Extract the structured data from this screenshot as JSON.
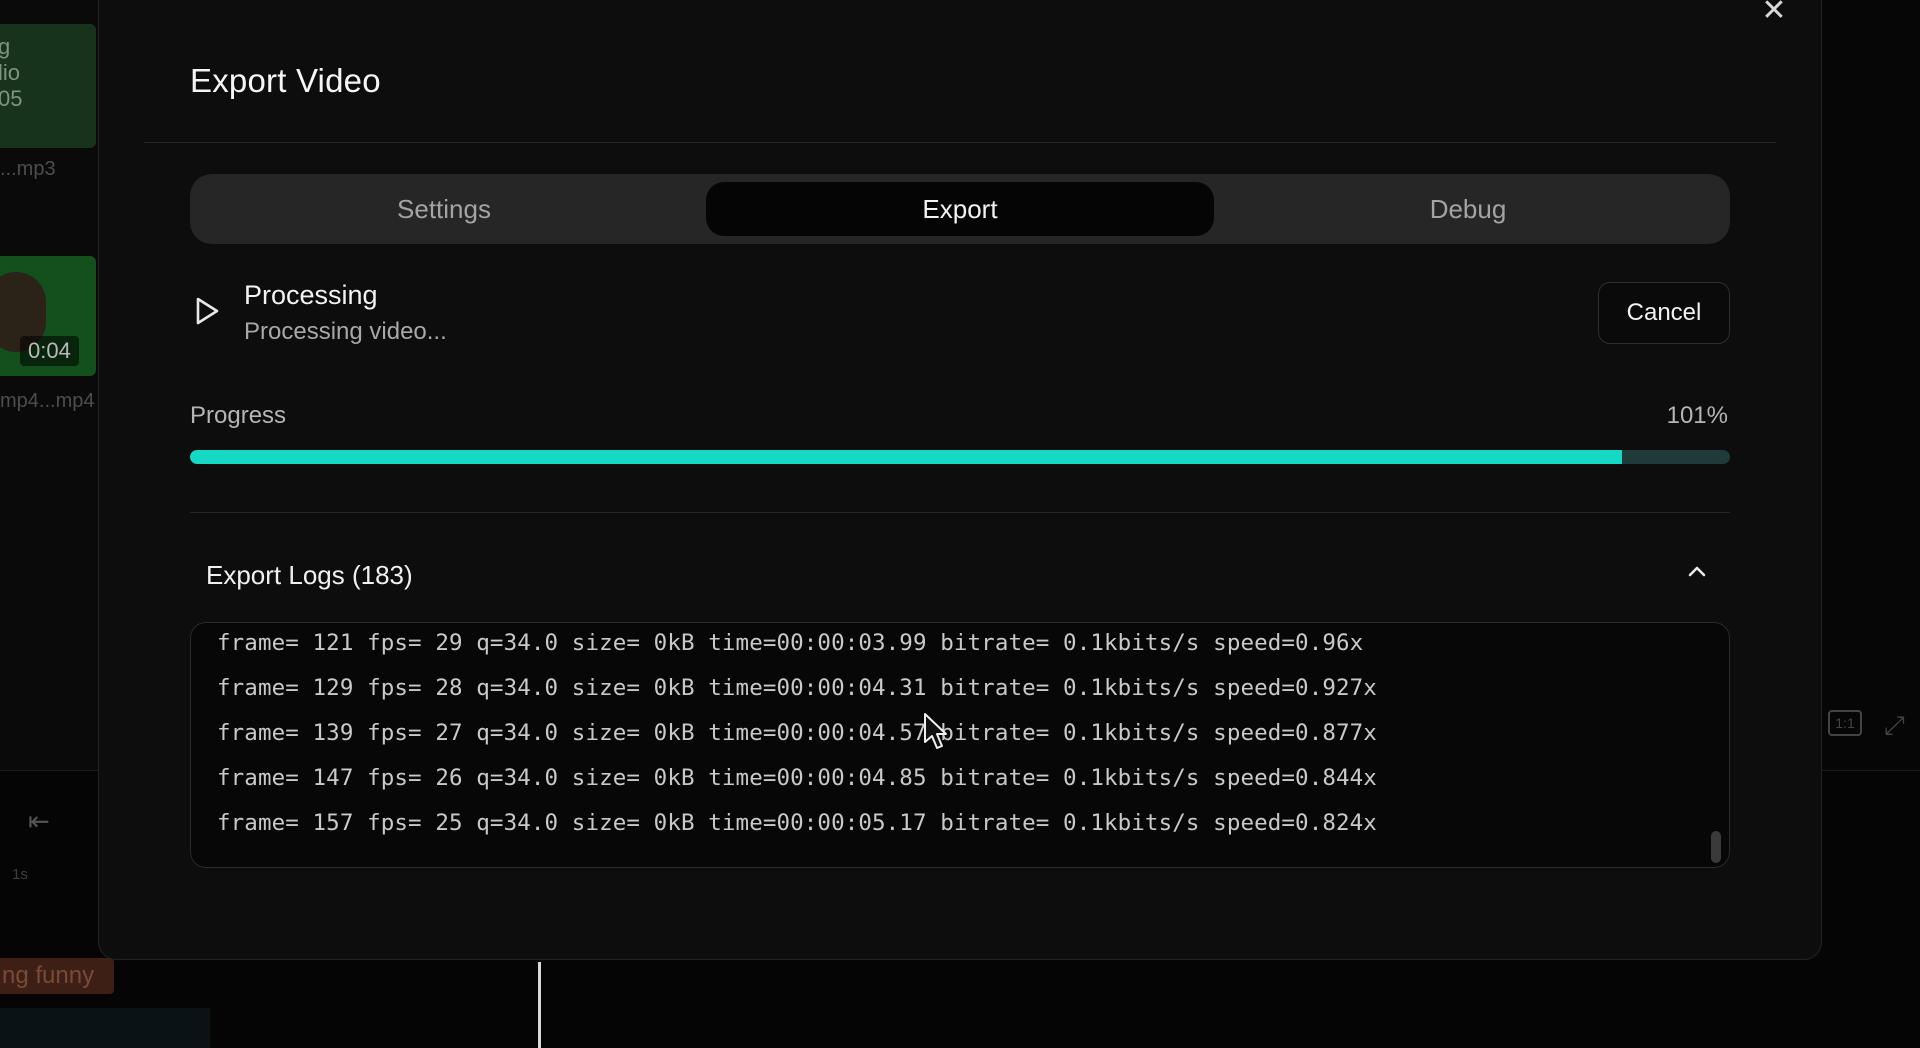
{
  "background": {
    "audio_thumb_lines": [
      "g",
      "lio",
      "05"
    ],
    "audio_file_name": "...mp3",
    "video_duration": "0:04",
    "video_file_name": "mp4...mp4",
    "ruler_label": "1s",
    "caption_clip_text": "ng funny",
    "ratio_label": "1:1"
  },
  "modal": {
    "title": "Export Video",
    "close_label": "✕"
  },
  "tabs": [
    {
      "label": "Settings",
      "active": false
    },
    {
      "label": "Export",
      "active": true
    },
    {
      "label": "Debug",
      "active": false
    }
  ],
  "status": {
    "title": "Processing",
    "subtitle": "Processing video...",
    "cancel_label": "Cancel"
  },
  "progress": {
    "label": "Progress",
    "value_text": "101%",
    "fill_fraction": 0.93,
    "accent_color": "#16d9c5"
  },
  "logs": {
    "title": "Export Logs (183)",
    "lines": [
      "frame= 121 fps= 29 q=34.0 size= 0kB time=00:00:03.99 bitrate= 0.1kbits/s speed=0.96x",
      "frame= 129 fps= 28 q=34.0 size= 0kB time=00:00:04.31 bitrate= 0.1kbits/s speed=0.927x",
      "frame= 139 fps= 27 q=34.0 size= 0kB time=00:00:04.57 bitrate= 0.1kbits/s speed=0.877x",
      "frame= 147 fps= 26 q=34.0 size= 0kB time=00:00:04.85 bitrate= 0.1kbits/s speed=0.844x",
      "frame= 157 fps= 25 q=34.0 size= 0kB time=00:00:05.17 bitrate= 0.1kbits/s speed=0.824x"
    ]
  },
  "icons": {
    "play": "play-icon",
    "chevron": "chevron-up-icon",
    "close": "close-icon",
    "cursor": "cursor-icon"
  }
}
